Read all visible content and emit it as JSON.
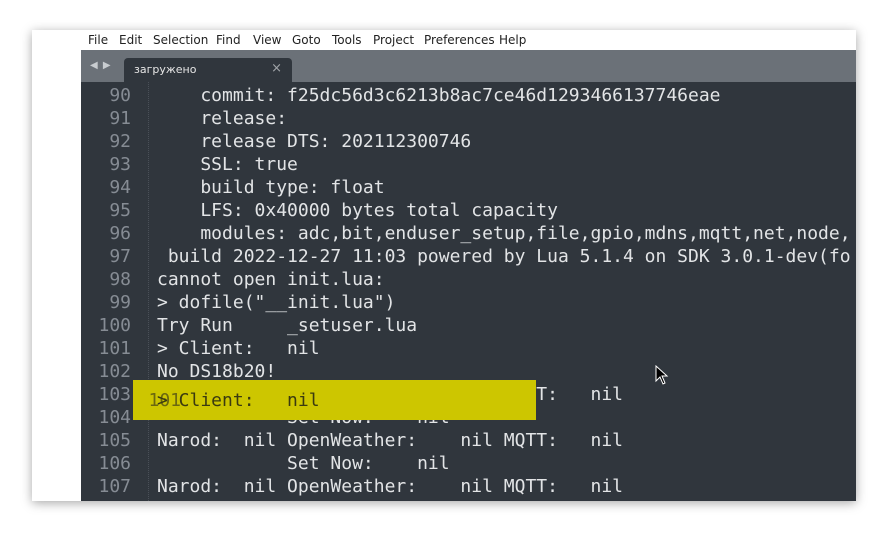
{
  "menu": [
    "File",
    "Edit",
    "Selection",
    "Find",
    "View",
    "Goto",
    "Tools",
    "Project",
    "Preferences",
    "Help"
  ],
  "tab": {
    "title": "загружено",
    "close": "×",
    "nav": "◀ ▶"
  },
  "lines": [
    {
      "n": "90",
      "t": "    commit: f25dc56d3c6213b8ac7ce46d1293466137746eae"
    },
    {
      "n": "91",
      "t": "    release:"
    },
    {
      "n": "92",
      "t": "    release DTS: 202112300746"
    },
    {
      "n": "93",
      "t": "    SSL: true"
    },
    {
      "n": "94",
      "t": "    build type: float"
    },
    {
      "n": "95",
      "t": "    LFS: 0x40000 bytes total capacity"
    },
    {
      "n": "96",
      "t": "    modules: adc,bit,enduser_setup,file,gpio,mdns,mqtt,net,node,"
    },
    {
      "n": "97",
      "t": " build 2022-12-27 11:03 powered by Lua 5.1.4 on SDK 3.0.1-dev(fo"
    },
    {
      "n": "98",
      "t": "cannot open init.lua:"
    },
    {
      "n": "99",
      "t": "> dofile(\"__init.lua\")"
    },
    {
      "n": "100",
      "t": "Try Run     _setuser.lua"
    },
    {
      "n": "101",
      "t": "> Client:   nil"
    },
    {
      "n": "102",
      "t": "No DS18b20!"
    },
    {
      "n": "103",
      "t": "Narod:  nil OpenWeather:    nil MQTT:   nil"
    },
    {
      "n": "104",
      "t": "            Set Now:    nil"
    },
    {
      "n": "105",
      "t": "Narod:  nil OpenWeather:    nil MQTT:   nil"
    },
    {
      "n": "106",
      "t": "            Set Now:    nil"
    },
    {
      "n": "107",
      "t": "Narod:  nil OpenWeather:    nil MQTT:   nil"
    }
  ],
  "highlight": {
    "line": "101",
    "text": "> Client:   nil",
    "color": "#cdc600"
  }
}
